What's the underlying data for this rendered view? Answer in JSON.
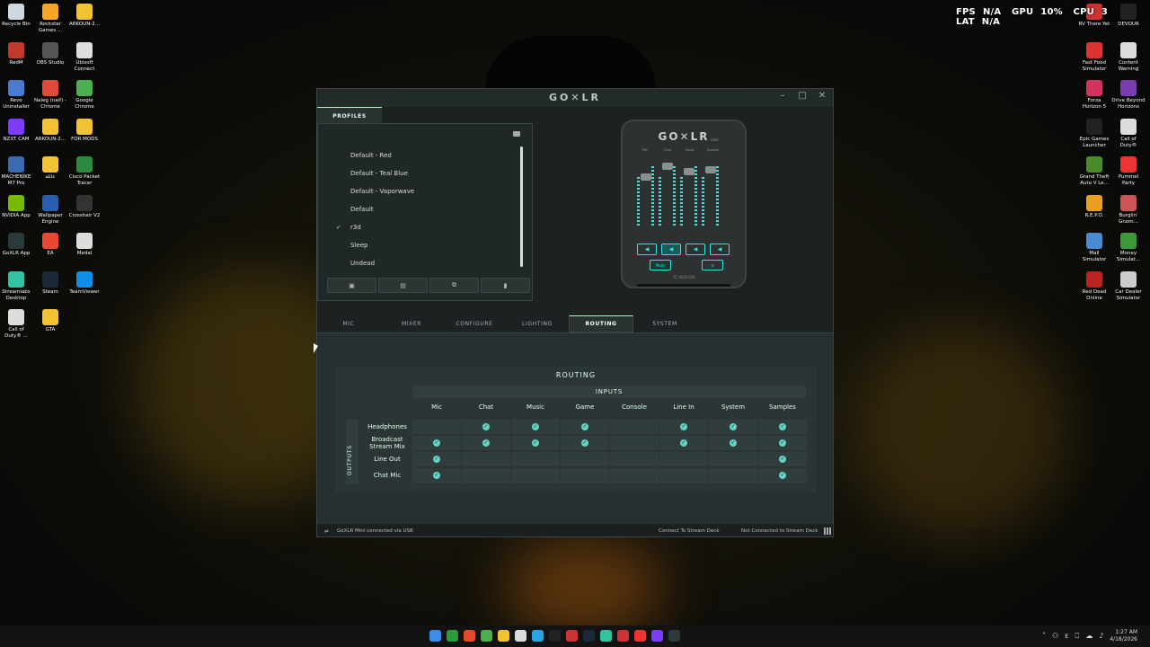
{
  "hud": {
    "fps_label": "FPS",
    "fps_value": "N/A",
    "gpu_label": "GPU",
    "gpu_value": "10%",
    "cpu_label": "CPU",
    "cpu_value": "3",
    "lat_label": "LAT",
    "lat_value": "N/A"
  },
  "desktop_left": [
    {
      "label": "Recycle Bin",
      "color": "#cfd8e0"
    },
    {
      "label": "Rockstar\nGames ...",
      "color": "#f5a623"
    },
    {
      "label": "ARKOUN-2...",
      "color": "#f1c232"
    },
    {
      "label": "RedM",
      "color": "#c0392b"
    },
    {
      "label": "OBS Studio",
      "color": "#555"
    },
    {
      "label": "Ubisoft\nConnect",
      "color": "#ddd"
    },
    {
      "label": "Revo\nUninstaller",
      "color": "#4a7bd0"
    },
    {
      "label": "Naieg (naif) -\nChrome",
      "color": "#e04a3a"
    },
    {
      "label": "Google\nChrome",
      "color": "#4caf50"
    },
    {
      "label": "NZXT CAM",
      "color": "#7d3cff"
    },
    {
      "label": "ARKOUN-2...",
      "color": "#f1c232"
    },
    {
      "label": "FOR MODS",
      "color": "#f1c232"
    },
    {
      "label": "MACHENIKE\nM7 Pro",
      "color": "#3a6ab0"
    },
    {
      "label": "عائلة",
      "color": "#f1c232"
    },
    {
      "label": "Cisco Packet\nTracer",
      "color": "#2b8a3e"
    },
    {
      "label": "NVIDIA App",
      "color": "#76b900"
    },
    {
      "label": "Wallpaper\nEngine",
      "color": "#2a5db0"
    },
    {
      "label": "Crosshair V2",
      "color": "#333"
    },
    {
      "label": "GoXLR App",
      "color": "#2a3a3a"
    },
    {
      "label": "EA",
      "color": "#e8482f"
    },
    {
      "label": "Medal",
      "color": "#ddd"
    },
    {
      "label": "Streamlabs\nDesktop",
      "color": "#31c3a2"
    },
    {
      "label": "Steam",
      "color": "#1b2838"
    },
    {
      "label": "TeamViewer",
      "color": "#0e8ee9"
    },
    {
      "label": "Call of\nDuty® ...",
      "color": "#ddd"
    },
    {
      "label": "GTA",
      "color": "#f1c232"
    }
  ],
  "desktop_right": [
    {
      "label": "RV There Yet",
      "color": "#c33"
    },
    {
      "label": "DEVOUR",
      "color": "#222"
    },
    {
      "label": "Fast Food\nSimulator",
      "color": "#d33"
    },
    {
      "label": "Content\nWarning",
      "color": "#ddd"
    },
    {
      "label": "Forza\nHorizon 5",
      "color": "#d2335e"
    },
    {
      "label": "Drive Beyond\nHorizons",
      "color": "#7a3cb0"
    },
    {
      "label": "Epic Games\nLauncher",
      "color": "#222"
    },
    {
      "label": "Call of\nDuty®",
      "color": "#ddd"
    },
    {
      "label": "Grand Theft\nAuto V Le...",
      "color": "#4a8a2a"
    },
    {
      "label": "Pummel\nParty",
      "color": "#e33"
    },
    {
      "label": "R.E.P.O.",
      "color": "#e9a021"
    },
    {
      "label": "Burglin'\nGnom...",
      "color": "#c55"
    },
    {
      "label": "Mall\nSimulator",
      "color": "#4a8ad0"
    },
    {
      "label": "Money\nSimulat...",
      "color": "#3a9a3a"
    },
    {
      "label": "Red Dead\nOnline",
      "color": "#b22"
    },
    {
      "label": "Car Dealer\nSimulator",
      "color": "#ccc"
    }
  ],
  "window": {
    "title": "GO✕LR",
    "minimize": "–",
    "maximize": "□",
    "close": "✕"
  },
  "profiles": {
    "tab_label": "PROFILES",
    "items": [
      "Default - Red",
      "Default - Teal Blue",
      "Default - Vaporwave",
      "Default",
      "r3d",
      "Sleep",
      "Undead"
    ],
    "selected_index": 4,
    "check": "✓",
    "actions": [
      "▣",
      "▤",
      "⧉",
      "▮"
    ]
  },
  "device": {
    "logo": "GO✕LR",
    "logo_sub": "mini",
    "channels": [
      "Mic",
      "Chat",
      "Music",
      "System"
    ],
    "fx": "Mute",
    "sampler": "☰",
    "maker": "TC HELICON"
  },
  "tabs": [
    "MIC",
    "MIXER",
    "CONFIGURE",
    "LIGHTING",
    "ROUTING",
    "SYSTEM"
  ],
  "active_tab": "ROUTING",
  "routing": {
    "title": "ROUTING",
    "inputs_label": "INPUTS",
    "outputs_label": "OUTPUTS",
    "columns": [
      "Mic",
      "Chat",
      "Music",
      "Game",
      "Console",
      "Line In",
      "System",
      "Samples"
    ],
    "rows": [
      {
        "label": "Headphones",
        "values": [
          false,
          true,
          true,
          true,
          false,
          true,
          true,
          true
        ]
      },
      {
        "label": "Broadcast\nStream Mix",
        "values": [
          true,
          true,
          true,
          true,
          false,
          true,
          true,
          true
        ]
      },
      {
        "label": "Line Out",
        "values": [
          true,
          false,
          false,
          false,
          false,
          false,
          false,
          true
        ]
      },
      {
        "label": "Chat Mic",
        "values": [
          true,
          false,
          false,
          false,
          false,
          false,
          false,
          true
        ]
      }
    ]
  },
  "status": {
    "usb_icon": "⮂",
    "connection": "GoXLR Mini connected via USB",
    "stream_deck_link": "Connect To Stream Deck",
    "stream_deck_status": "Not Connected to Stream Deck"
  },
  "taskbar": {
    "icons": [
      "#3b8ee8",
      "#2a9a3a",
      "#e34a2a",
      "#4caf50",
      "#f1c232",
      "#ddd",
      "#2aa3e0",
      "#222",
      "#c33",
      "#1b2838",
      "#31c3a2",
      "#c33",
      "#e33",
      "#7a3cff",
      "#2a3a3a"
    ],
    "time": "1:27 AM",
    "date": "4/18/2026",
    "tray": [
      "˄",
      "⚇",
      "ε",
      "⎕",
      "☁",
      "♪"
    ]
  }
}
